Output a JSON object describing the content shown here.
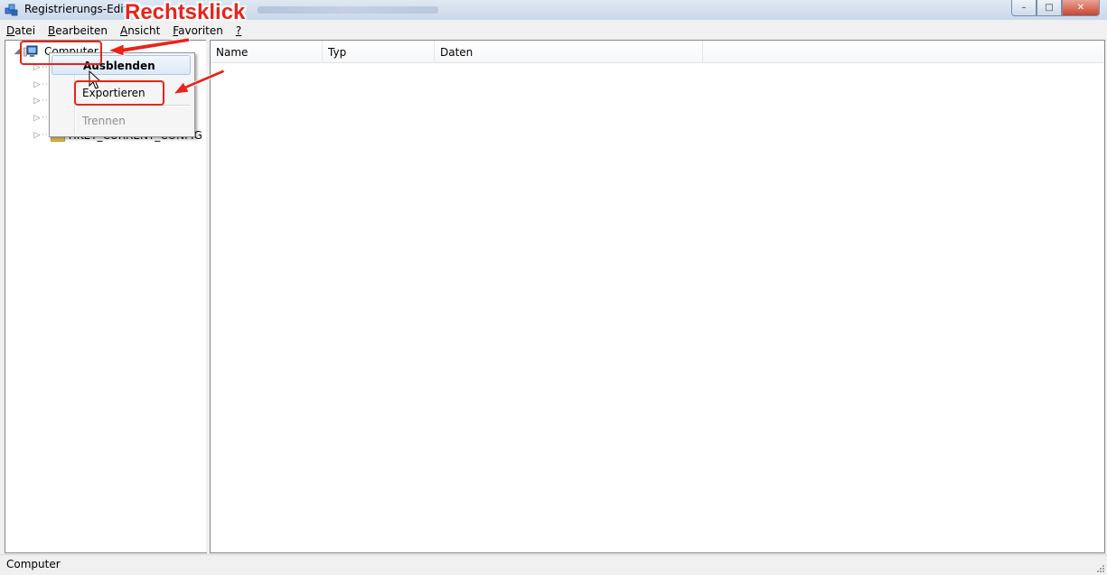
{
  "window": {
    "title": "Registrierungs-Editor",
    "buttons": {
      "minimize": "–",
      "maximize": "□",
      "close": "✕"
    }
  },
  "menubar": {
    "items": [
      {
        "label": "Datei",
        "accel": "D",
        "rest": "atei"
      },
      {
        "label": "Bearbeiten",
        "accel": "B",
        "rest": "earbeiten"
      },
      {
        "label": "Ansicht",
        "accel": "A",
        "rest": "nsicht"
      },
      {
        "label": "Favoriten",
        "accel": "F",
        "rest": "avoriten"
      },
      {
        "label": "?",
        "accel": "?",
        "rest": ""
      }
    ]
  },
  "tree": {
    "root": "Computer",
    "children": [
      "",
      "",
      "",
      "",
      "HKEY_CURRENT_CONFIG"
    ]
  },
  "list": {
    "columns": [
      "Name",
      "Typ",
      "Daten"
    ]
  },
  "context_menu": {
    "items": [
      {
        "label": "Ausblenden",
        "state": "hover-default"
      },
      {
        "label": "Exportieren",
        "state": "normal"
      },
      {
        "label": "Trennen",
        "state": "disabled"
      }
    ]
  },
  "annotation": {
    "label": "Rechtsklick",
    "color": "#e8241a"
  },
  "statusbar": {
    "text": "Computer"
  }
}
